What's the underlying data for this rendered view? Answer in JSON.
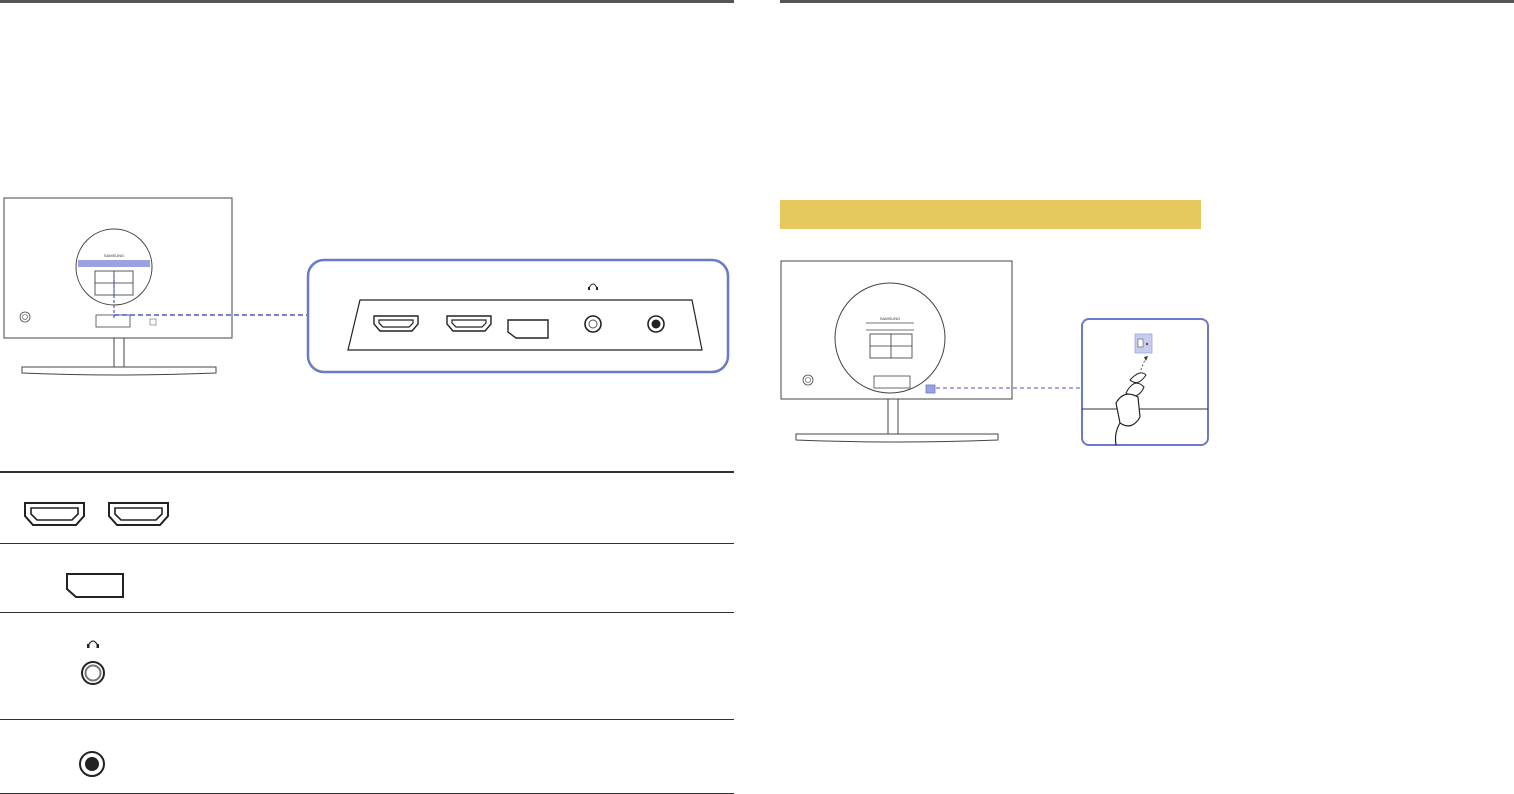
{
  "colors": {
    "accent_outline": "#6a79c8",
    "highlight_fill": "#9aa2e0",
    "banner": "#e6c85e",
    "line": "#333333"
  },
  "monitor": {
    "brand": "SAMSUNG"
  },
  "icons": {
    "headphone_symbol": "headphone-icon",
    "hdmi_port": "hdmi-port-icon",
    "displayport": "displayport-icon",
    "audio_jack": "headphone-jack-icon",
    "dc_jack": "dc-power-jack-icon",
    "kensington_lock": "kensington-lock-icon"
  },
  "port_table": {
    "rows": [
      {
        "icon": "hdmi-port-icon",
        "count": 2
      },
      {
        "icon": "displayport-icon",
        "count": 1
      },
      {
        "icon": "headphone-jack-icon",
        "count": 1
      },
      {
        "icon": "dc-power-jack-icon",
        "count": 1
      }
    ]
  }
}
